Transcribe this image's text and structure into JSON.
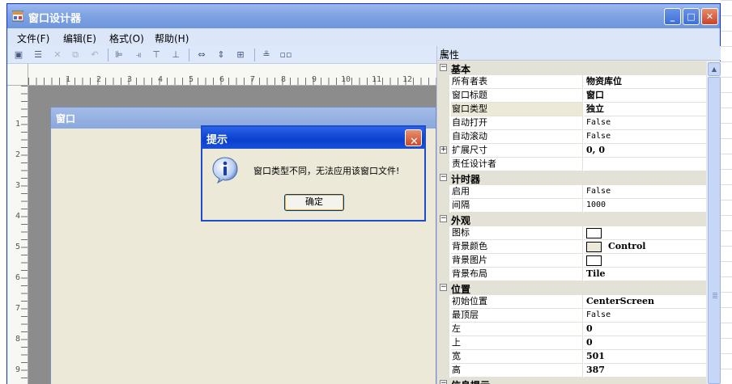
{
  "window": {
    "title": "窗口设计器"
  },
  "menu": {
    "items": [
      "文件(F)",
      "编辑(E)",
      "格式(O)",
      "帮助(H)"
    ]
  },
  "ruler": {
    "h_numbers": [
      "1",
      "2",
      "3",
      "4",
      "5",
      "6",
      "7",
      "8",
      "9",
      "10",
      "11",
      "12"
    ],
    "v_numbers": [
      "1",
      "2",
      "3",
      "4",
      "5",
      "6",
      "7",
      "8",
      "9"
    ]
  },
  "design_form": {
    "title": "窗口"
  },
  "message_box": {
    "title": "提示",
    "text": "窗口类型不同，无法应用该窗口文件!",
    "ok_label": "确定",
    "icon": "info-icon"
  },
  "properties": {
    "header": "属性",
    "pin_glyph": "📌",
    "categories": [
      {
        "name": "基本",
        "rows": [
          {
            "name": "所有者表",
            "value": "物资库位",
            "style": "bold"
          },
          {
            "name": "窗口标题",
            "value": "窗口",
            "style": "bold"
          },
          {
            "name": "窗口类型",
            "value": "独立",
            "style": "bold",
            "selected": true
          },
          {
            "name": "自动打开",
            "value": "False",
            "style": "mono"
          },
          {
            "name": "自动滚动",
            "value": "False",
            "style": "mono"
          },
          {
            "name": "扩展尺寸",
            "value": "0, 0",
            "style": "bold",
            "expandable": true
          },
          {
            "name": "责任设计者",
            "value": "",
            "style": ""
          }
        ]
      },
      {
        "name": "计时器",
        "rows": [
          {
            "name": "启用",
            "value": "False",
            "style": "mono"
          },
          {
            "name": "间隔",
            "value": "1000",
            "style": "mono"
          }
        ]
      },
      {
        "name": "外观",
        "rows": [
          {
            "name": "图标",
            "value": "",
            "style": "",
            "swatch": "#ffffff"
          },
          {
            "name": "背景颜色",
            "value": "Control",
            "style": "bold",
            "swatch": "#ece9d8"
          },
          {
            "name": "背景图片",
            "value": "",
            "style": "",
            "swatch": "#ffffff"
          },
          {
            "name": "背景布局",
            "value": "Tile",
            "style": "bold"
          }
        ]
      },
      {
        "name": "位置",
        "rows": [
          {
            "name": "初始位置",
            "value": "CenterScreen",
            "style": "bold"
          },
          {
            "name": "最顶层",
            "value": "False",
            "style": "mono"
          },
          {
            "name": "左",
            "value": "0",
            "style": "bold"
          },
          {
            "name": "上",
            "value": "0",
            "style": "bold"
          },
          {
            "name": "宽",
            "value": "501",
            "style": "bold"
          },
          {
            "name": "高",
            "value": "387",
            "style": "bold"
          }
        ]
      },
      {
        "name": "信息提示",
        "rows": []
      }
    ]
  },
  "colors": {
    "titlebar": "#7fa3e3",
    "msg_titlebar": "#0a3fcf",
    "category_bg": "#e4e2d6"
  }
}
